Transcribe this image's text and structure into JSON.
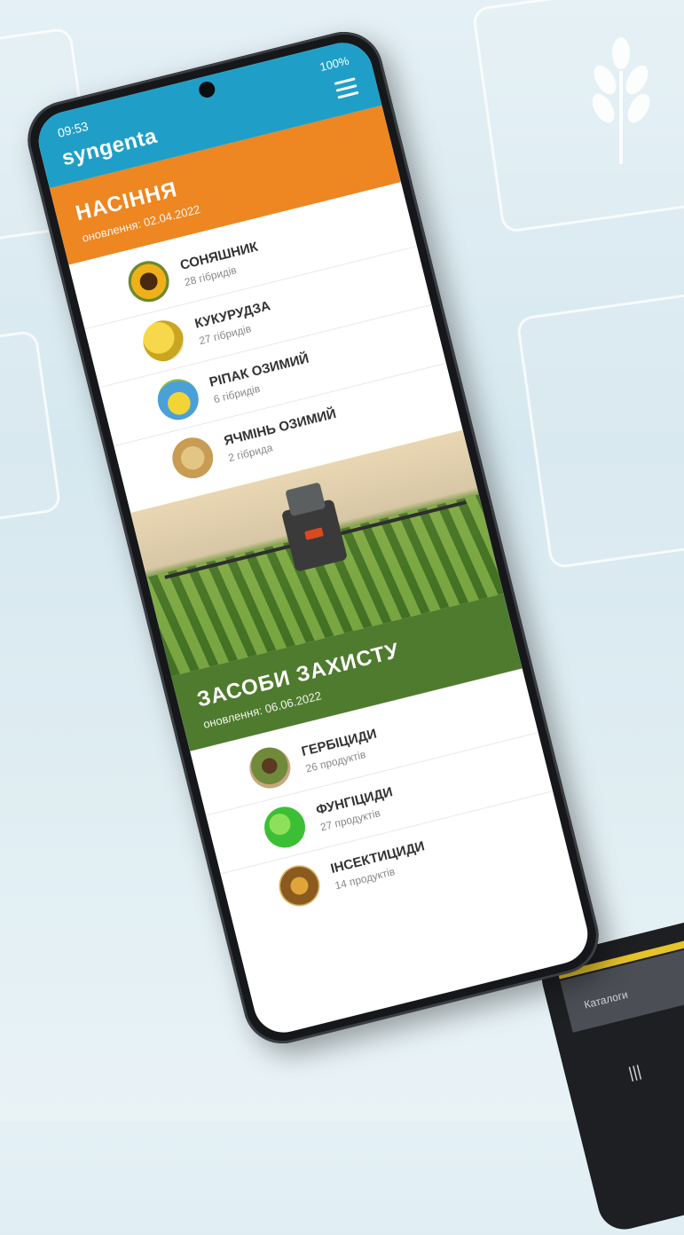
{
  "status": {
    "time": "09:53",
    "indicators": "100%"
  },
  "brand": {
    "logo": "syngenta",
    "menu_icon": "hamburger-icon"
  },
  "seeds": {
    "title": "НАСІННЯ",
    "updated": "оновлення: 02.04.2022",
    "color": "#ee8621",
    "items": [
      {
        "name": "СОНЯШНИК",
        "count": "28 гібридів",
        "icon": "sunflower"
      },
      {
        "name": "КУКУРУДЗА",
        "count": "27 гібридів",
        "icon": "corn"
      },
      {
        "name": "РІПАК ОЗИМИЙ",
        "count": "6 гібридів",
        "icon": "rapeseed"
      },
      {
        "name": "ЯЧМІНЬ ОЗИМИЙ",
        "count": "2 гібрида",
        "icon": "barley"
      }
    ]
  },
  "protection": {
    "title": "ЗАСОБИ ЗАХИСТУ",
    "updated": "оновлення: 06.06.2022",
    "color": "#4f7b2e",
    "items": [
      {
        "name": "ГЕРБІЦИДИ",
        "count": "26 продуктів",
        "icon": "herbicide"
      },
      {
        "name": "ФУНГІЦИДИ",
        "count": "27 продуктів",
        "icon": "fungicide"
      },
      {
        "name": "ІНСЕКТИЦИДИ",
        "count": "14 продуктів",
        "icon": "insecticide"
      }
    ]
  },
  "second_phone": {
    "tab_label": "Каталоги"
  }
}
